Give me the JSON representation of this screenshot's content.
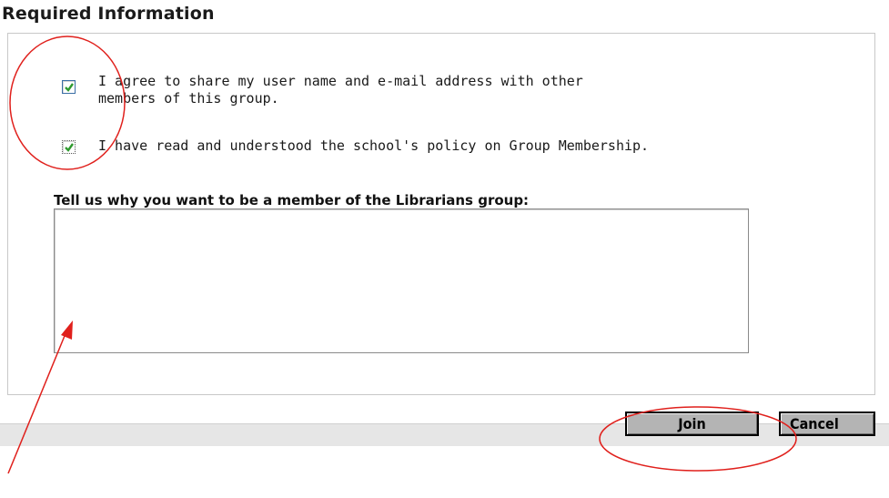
{
  "section": {
    "title": "Required Information"
  },
  "options": [
    {
      "line1": "I agree to share my user name and e-mail address with other",
      "line2": "members of this group.",
      "checked": true
    },
    {
      "line1": "I have read and understood the school's policy on Group Membership.",
      "checked": true
    }
  ],
  "reason": {
    "label": "Tell us why you want to be a member of the Librarians group:",
    "value": ""
  },
  "actions": {
    "join_label": "Join",
    "cancel_label": "Cancel"
  },
  "colors": {
    "annotation": "#e0201c",
    "checkmark": "#2f9a2f",
    "button_face": "#b4b4b4",
    "footer_bar": "#e6e6e6"
  }
}
